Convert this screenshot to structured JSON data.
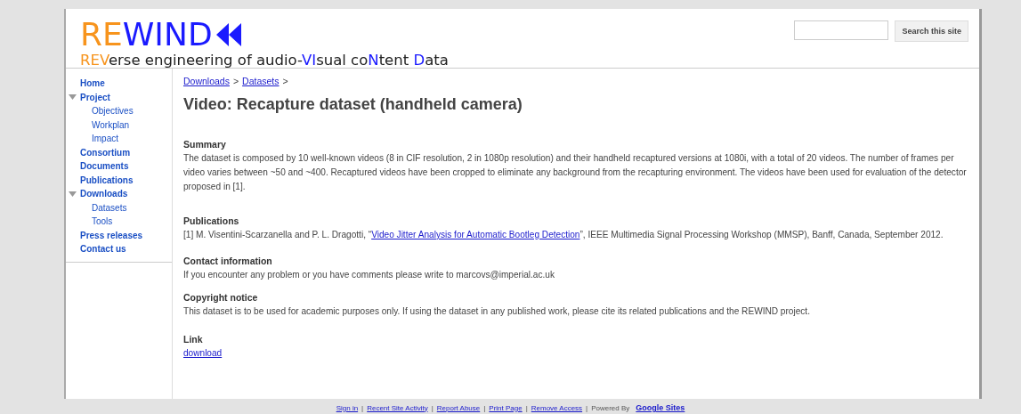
{
  "logo": {
    "segments": [
      {
        "text": "RE",
        "color": "#f7941d"
      },
      {
        "text": "WIND",
        "color": "#1a1aff"
      }
    ]
  },
  "tagline": {
    "segments": [
      {
        "text": "REV",
        "color": "#f7941d"
      },
      {
        "text": "erse engineering of audio-",
        "color": "#222222"
      },
      {
        "text": "VI",
        "color": "#1a1aff"
      },
      {
        "text": "sual co",
        "color": "#222222"
      },
      {
        "text": "N",
        "color": "#1a1aff"
      },
      {
        "text": "tent ",
        "color": "#222222"
      },
      {
        "text": "D",
        "color": "#1a1aff"
      },
      {
        "text": "ata",
        "color": "#222222"
      }
    ]
  },
  "search": {
    "button": "Search this site"
  },
  "sidebar": {
    "items": [
      {
        "label": "Home"
      },
      {
        "label": "Project",
        "expanded": true,
        "children": [
          {
            "label": "Objectives"
          },
          {
            "label": "Workplan"
          },
          {
            "label": "Impact"
          }
        ]
      },
      {
        "label": "Consortium"
      },
      {
        "label": "Documents"
      },
      {
        "label": "Publications"
      },
      {
        "label": "Downloads",
        "expanded": true,
        "children": [
          {
            "label": "Datasets"
          },
          {
            "label": "Tools"
          }
        ]
      },
      {
        "label": "Press releases"
      },
      {
        "label": "Contact us"
      }
    ]
  },
  "breadcrumb": [
    {
      "label": "Downloads"
    },
    {
      "label": "Datasets"
    }
  ],
  "breadcrumb_separator": ">",
  "page_title": "Video: Recapture dataset (handheld camera)",
  "sections": [
    {
      "heading": "Summary",
      "parts": [
        {
          "kind": "text",
          "text": "The dataset is composed by 10 well-known videos (8 in CIF resolution, 2 in 1080p resolution) and their handheld recaptured versions at 1080i, with a total of 20 videos. The number of frames per video varies between ~50 and ~400. Recaptured videos have been cropped to eliminate any background from the recapturing environment. The videos have been used for evaluation of the detector proposed in [1]."
        }
      ]
    },
    {
      "heading": "Publications",
      "parts": [
        {
          "kind": "text",
          "text": "[1] M. Visentini-Scarzanella and P. L. Dragotti, “"
        },
        {
          "kind": "link",
          "text": "Video Jitter Analysis for Automatic Bootleg Detection"
        },
        {
          "kind": "text",
          "text": "”, IEEE Multimedia Signal Processing Workshop (MMSP), Banff, Canada, September 2012."
        }
      ]
    },
    {
      "heading": "Contact information",
      "parts": [
        {
          "kind": "text",
          "text": "If you encounter any problem or you have comments please write to marcovs@imperial.ac.uk"
        }
      ]
    },
    {
      "heading": "Copyright notice",
      "parts": [
        {
          "kind": "text",
          "text": "This dataset is to be used for academic purposes only. If using the dataset in any published work, please cite its related publications and the REWIND project."
        }
      ]
    },
    {
      "heading": "Link",
      "parts": [
        {
          "kind": "link",
          "text": "download"
        }
      ]
    }
  ],
  "footer": {
    "links": [
      "Sign in",
      "Recent Site Activity",
      "Report Abuse",
      "Print Page",
      "Remove Access"
    ],
    "separator": "|",
    "powered_by": "Powered By",
    "brand": "Google Sites"
  }
}
